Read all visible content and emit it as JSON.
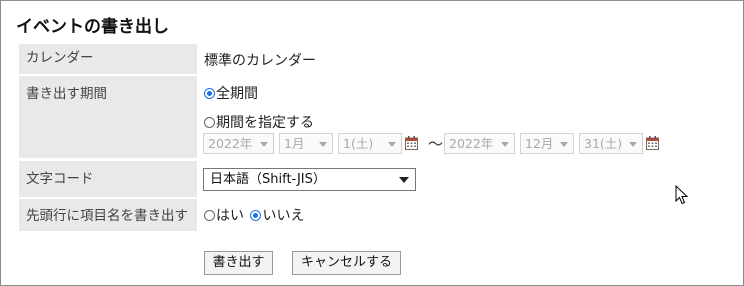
{
  "dialog": {
    "title": "イベントの書き出し"
  },
  "form": {
    "calendar": {
      "label": "カレンダー",
      "value": "標準のカレンダー"
    },
    "period": {
      "label": "書き出す期間",
      "option_all": "全期間",
      "option_range": "期間を指定する",
      "selected": "all",
      "start": {
        "year": "2022年",
        "month": "1月",
        "day": "1(土)"
      },
      "separator": "～",
      "end": {
        "year": "2022年",
        "month": "12月",
        "day": "31(土)"
      }
    },
    "charset": {
      "label": "文字コード",
      "value": "日本語（Shift-JIS）"
    },
    "header_row": {
      "label": "先頭行に項目名を書き出す",
      "option_yes": "はい",
      "option_no": "いいえ",
      "selected": "no"
    }
  },
  "buttons": {
    "export": "書き出す",
    "cancel": "キャンセルする"
  },
  "icons": {
    "calendar": "calendar-icon",
    "cursor": "mouse-pointer-icon"
  },
  "colors": {
    "accent": "#1a73e8",
    "label_bg": "#e9e9e9",
    "disabled": "#a9a9a9"
  }
}
